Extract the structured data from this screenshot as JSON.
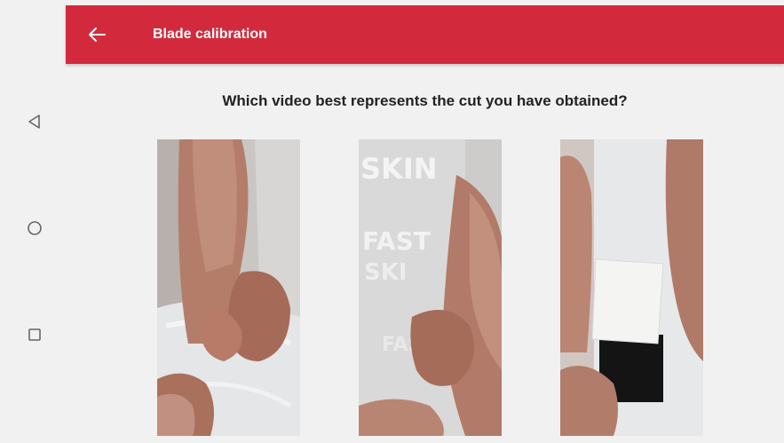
{
  "system_nav": {
    "back_icon": "triangle-back-icon",
    "home_icon": "circle-home-icon",
    "recents_icon": "square-recents-icon"
  },
  "appbar": {
    "title": "Blade calibration",
    "back_icon": "arrow-left-icon",
    "color": "#d22a3c"
  },
  "question": "Which video best represents the cut you have obtained?",
  "video_options": [
    {
      "print": []
    },
    {
      "print": [
        "SKIN",
        "FAST",
        "SKI",
        "FAS"
      ]
    },
    {
      "print": []
    }
  ]
}
